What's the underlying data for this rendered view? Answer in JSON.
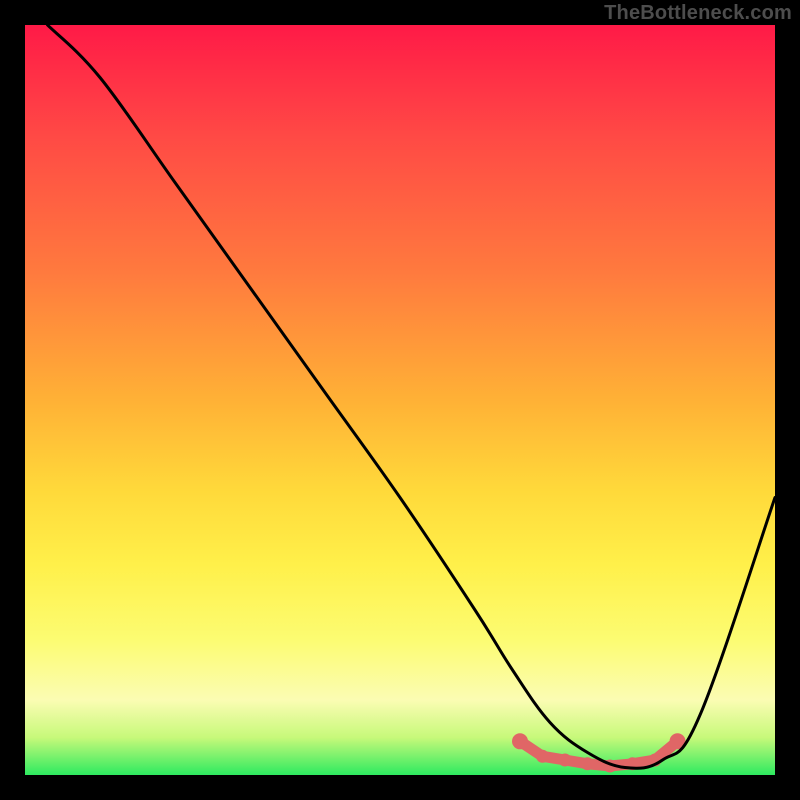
{
  "watermark": "TheBottleneck.com",
  "chart_data": {
    "type": "line",
    "title": "",
    "xlabel": "",
    "ylabel": "",
    "xlim": [
      0,
      100
    ],
    "ylim": [
      0,
      100
    ],
    "series": [
      {
        "name": "bottleneck-curve",
        "x": [
          3,
          10,
          20,
          30,
          40,
          50,
          60,
          65,
          70,
          75,
          80,
          85,
          90,
          100
        ],
        "values": [
          100,
          93,
          79,
          65,
          51,
          37,
          22,
          14,
          7,
          3,
          1,
          2,
          8,
          37
        ]
      }
    ],
    "highlight": {
      "name": "optimal-range",
      "x_start": 66,
      "x_end": 87,
      "y_min": 0,
      "points": [
        {
          "x": 66,
          "y": 4.5
        },
        {
          "x": 69,
          "y": 2.5
        },
        {
          "x": 72,
          "y": 2.0
        },
        {
          "x": 75,
          "y": 1.5
        },
        {
          "x": 78,
          "y": 1.2
        },
        {
          "x": 81,
          "y": 1.5
        },
        {
          "x": 84,
          "y": 2.0
        },
        {
          "x": 87,
          "y": 4.5
        }
      ]
    },
    "axes_visible": false,
    "grid": false
  }
}
